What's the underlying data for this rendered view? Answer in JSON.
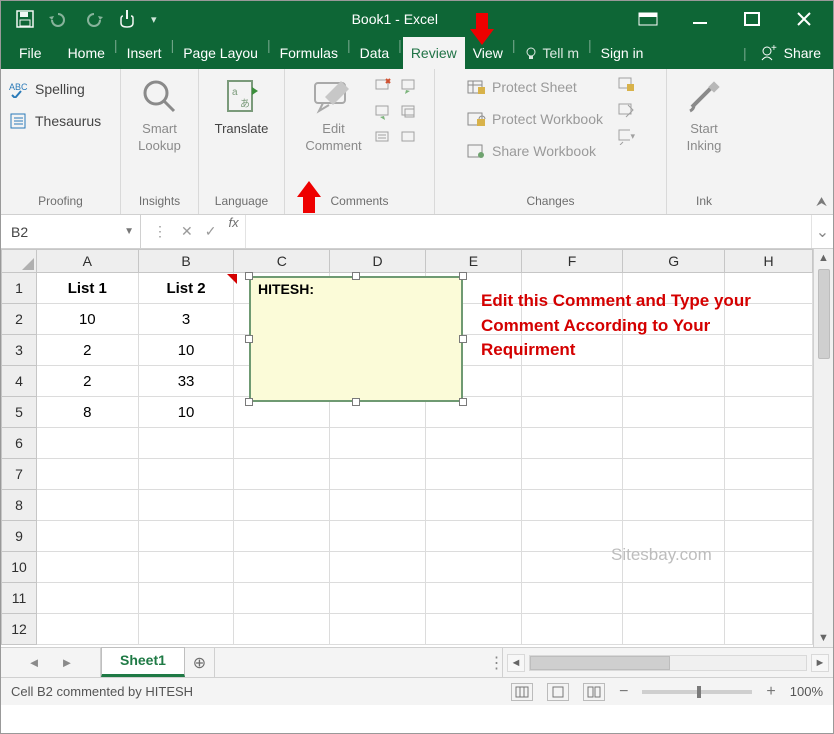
{
  "title": "Book1 - Excel",
  "qat": {
    "save": "save",
    "undo": "undo",
    "redo": "redo",
    "touch": "touch"
  },
  "tabs": [
    "File",
    "Home",
    "Insert",
    "Page Layou",
    "Formulas",
    "Data",
    "Review",
    "View"
  ],
  "active_tab": "Review",
  "tell_me": "Tell m",
  "signin": "Sign in",
  "share": "Share",
  "ribbon": {
    "proofing": {
      "label": "Proofing",
      "spelling": "Spelling",
      "thesaurus": "Thesaurus"
    },
    "insights": {
      "label": "Insights",
      "smart1": "Smart",
      "smart2": "Lookup"
    },
    "language": {
      "label": "Language",
      "translate": "Translate"
    },
    "comments": {
      "label": "Comments",
      "edit1": "Edit",
      "edit2": "Comment"
    },
    "changes": {
      "label": "Changes",
      "protect_sheet": "Protect Sheet",
      "protect_wb": "Protect Workbook",
      "share_wb": "Share Workbook"
    },
    "ink": {
      "label": "Ink",
      "start1": "Start",
      "start2": "Inking"
    }
  },
  "namebox": "B2",
  "fx_label": "fx",
  "sheet": {
    "cols": [
      "A",
      "B",
      "C",
      "D",
      "E",
      "F",
      "G",
      "H"
    ],
    "rows": [
      "1",
      "2",
      "3",
      "4",
      "5",
      "6",
      "7",
      "8",
      "9",
      "10",
      "11",
      "12"
    ],
    "data": {
      "header": [
        "List 1",
        "List 2"
      ],
      "values": [
        [
          "10",
          "3"
        ],
        [
          "2",
          "10"
        ],
        [
          "2",
          "33"
        ],
        [
          "8",
          "10"
        ]
      ]
    }
  },
  "comment": {
    "author": "HITESH:"
  },
  "annotation": "Edit this Comment and Type your Comment According to Your Requirment",
  "watermark": "Sitesbay.com",
  "sheet_tab": "Sheet1",
  "statusbar": "Cell B2 commented by HITESH",
  "zoom": "100%",
  "chart_data": {
    "type": "table",
    "columns": [
      "List 1",
      "List 2"
    ],
    "rows": [
      [
        10,
        3
      ],
      [
        2,
        10
      ],
      [
        2,
        33
      ],
      [
        8,
        10
      ]
    ]
  }
}
